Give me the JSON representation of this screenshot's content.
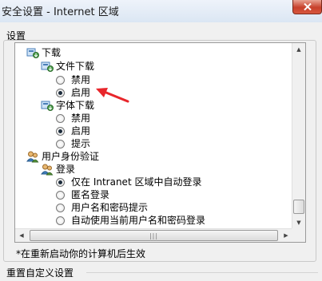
{
  "window": {
    "title": "安全设置 - Internet 区域"
  },
  "settings_label": "设置",
  "tree": {
    "items": [
      {
        "kind": "folder",
        "label": "下载"
      },
      {
        "kind": "folder",
        "label": "文件下载"
      },
      {
        "kind": "radio",
        "label": "禁用",
        "checked": false
      },
      {
        "kind": "radio",
        "label": "启用",
        "checked": true
      },
      {
        "kind": "folder",
        "label": "字体下载"
      },
      {
        "kind": "radio",
        "label": "禁用",
        "checked": false
      },
      {
        "kind": "radio",
        "label": "启用",
        "checked": true
      },
      {
        "kind": "radio",
        "label": "提示",
        "checked": false
      },
      {
        "kind": "user-folder",
        "label": "用户身份验证"
      },
      {
        "kind": "user-folder",
        "label": "登录"
      },
      {
        "kind": "radio",
        "label": "仅在 Intranet 区域中自动登录",
        "checked": true
      },
      {
        "kind": "radio",
        "label": "匿名登录",
        "checked": false
      },
      {
        "kind": "radio",
        "label": "用户名和密码提示",
        "checked": false
      },
      {
        "kind": "radio",
        "label": "自动使用当前用户名和密码登录",
        "checked": false
      }
    ]
  },
  "note": "*在重新启动你的计算机后生效",
  "reset_section": {
    "label": "重置自定义设置"
  },
  "colors": {
    "annotation_arrow": "#e8262b",
    "close_button": "#c7412b"
  }
}
